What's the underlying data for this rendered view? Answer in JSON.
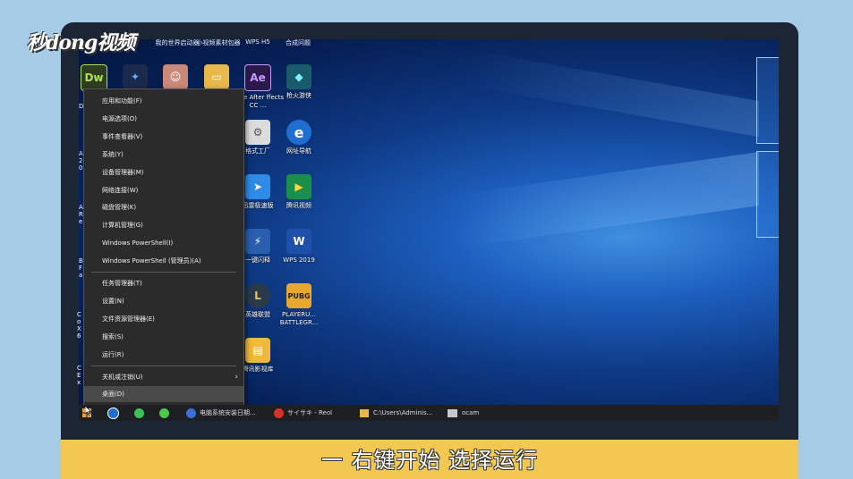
{
  "watermark": "秒dong视频",
  "top_labels": [
    "我的世界启动器",
    "小视频素材包器",
    "WPS H5",
    "合成问题"
  ],
  "desktop_icons": [
    {
      "label": "",
      "glyph": "Dw",
      "color": "#2f3c1f",
      "fg": "#a8e35a"
    },
    {
      "label": "",
      "glyph": "✦",
      "color": "#1b2a4a",
      "fg": "#5ab0ff"
    },
    {
      "label": "",
      "glyph": "☺",
      "color": "#c98a7a",
      "fg": "#fff"
    },
    {
      "label": "",
      "glyph": "▭",
      "color": "#e9b84a",
      "fg": "#fff"
    },
    {
      "label": "dobe After ffects CC ...",
      "glyph": "Ae",
      "color": "#2a1a4a",
      "fg": "#c79bff"
    },
    {
      "label": "枪火游侠",
      "glyph": "◆",
      "color": "#1b5a6a",
      "fg": "#7ff0ff"
    },
    {
      "label": "格式工厂",
      "glyph": "⚙",
      "color": "#dcdcdc",
      "fg": "#555"
    },
    {
      "label": "网址导航",
      "glyph": "e",
      "color": "#1f6fd0",
      "fg": "#fff"
    },
    {
      "label": "迅雷极速版",
      "glyph": "➤",
      "color": "#2e8be8",
      "fg": "#fff"
    },
    {
      "label": "腾讯视频",
      "glyph": "▶",
      "color": "#1a8f4a",
      "fg": "#ffd23f"
    },
    {
      "label": "一键闪释",
      "glyph": "⚡",
      "color": "#2a5fb0",
      "fg": "#fff"
    },
    {
      "label": "WPS 2019",
      "glyph": "W",
      "color": "#1f4fa8",
      "fg": "#fff"
    },
    {
      "label": "英雄联盟",
      "glyph": "L",
      "color": "#2a3a4a",
      "fg": "#e8c060"
    },
    {
      "label": "PLAYERU... BATTLEGR...",
      "glyph": "PUBG",
      "color": "#e8a830",
      "fg": "#222"
    },
    {
      "label": "腾讯影视库",
      "glyph": "▤",
      "color": "#f0b93a",
      "fg": "#fff"
    }
  ],
  "left_partial_labels": [
    "D",
    "A 20",
    "A Re",
    "B Fa",
    "Co X6",
    "C Ex"
  ],
  "context_menu": {
    "items": [
      "应用和功能(F)",
      "电源选项(O)",
      "事件查看器(V)",
      "系统(Y)",
      "设备管理器(M)",
      "网络连接(W)",
      "磁盘管理(K)",
      "计算机管理(G)",
      "Windows PowerShell(I)",
      "Windows PowerShell (管理员)(A)",
      "任务管理器(T)",
      "设置(N)",
      "文件资源管理器(E)",
      "搜索(S)",
      "运行(R)",
      "关机或注销(U)",
      "桌面(D)"
    ]
  },
  "taskbar": {
    "items": [
      {
        "label": "电脑系统安装日期...",
        "icon": "computer-app-icon"
      },
      {
        "label": "サイサキ - Reol",
        "icon": "netease-music-icon"
      },
      {
        "label": "C:\\Users\\Adminis...",
        "icon": "folder-icon"
      },
      {
        "label": "ocam",
        "icon": "ocam-icon"
      }
    ]
  },
  "caption": "一 右键开始 选择运行",
  "colors": {
    "caption_bg": "#f2c852",
    "frame": "#1b2533",
    "menu_bg": "#2b2b2b"
  }
}
